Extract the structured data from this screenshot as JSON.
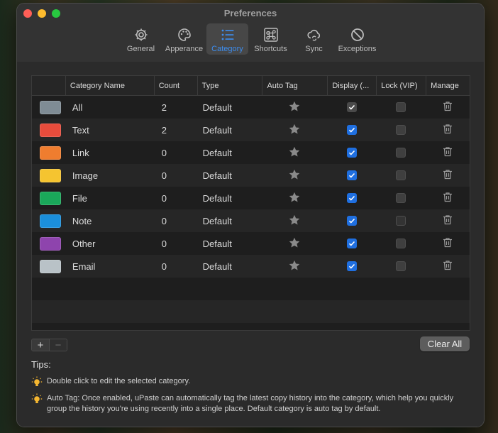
{
  "window": {
    "title": "Preferences"
  },
  "tabs": [
    {
      "label": "General",
      "icon": "gear-icon"
    },
    {
      "label": "Apperance",
      "icon": "palette-icon"
    },
    {
      "label": "Category",
      "icon": "list-icon",
      "active": true
    },
    {
      "label": "Shortcuts",
      "icon": "command-icon"
    },
    {
      "label": "Sync",
      "icon": "cloud-sync-icon"
    },
    {
      "label": "Exceptions",
      "icon": "prohibited-icon"
    }
  ],
  "table": {
    "headers": [
      "",
      "Category Name",
      "Count",
      "Type",
      "Auto Tag",
      "Display (...",
      "Lock (VIP)",
      "Manage"
    ],
    "rows": [
      {
        "color": "#7f8c95",
        "name": "All",
        "count": "2",
        "type": "Default",
        "display": true,
        "display_disabled": true,
        "lock": false,
        "lock_disabled": false
      },
      {
        "color": "#e74c3c",
        "name": "Text",
        "count": "2",
        "type": "Default",
        "display": true,
        "display_disabled": false,
        "lock": false,
        "lock_disabled": false
      },
      {
        "color": "#ef7d2f",
        "name": "Link",
        "count": "0",
        "type": "Default",
        "display": true,
        "display_disabled": false,
        "lock": false,
        "lock_disabled": false
      },
      {
        "color": "#f5c430",
        "name": "Image",
        "count": "0",
        "type": "Default",
        "display": true,
        "display_disabled": false,
        "lock": false,
        "lock_disabled": false
      },
      {
        "color": "#1aa85a",
        "name": "File",
        "count": "0",
        "type": "Default",
        "display": true,
        "display_disabled": false,
        "lock": false,
        "lock_disabled": false
      },
      {
        "color": "#1b8fdb",
        "name": "Note",
        "count": "0",
        "type": "Default",
        "display": true,
        "display_disabled": false,
        "lock": false,
        "lock_disabled": true
      },
      {
        "color": "#8e44ad",
        "name": "Other",
        "count": "0",
        "type": "Default",
        "display": true,
        "display_disabled": false,
        "lock": false,
        "lock_disabled": false
      },
      {
        "color": "#b9c2c7",
        "name": "Email",
        "count": "0",
        "type": "Default",
        "display": true,
        "display_disabled": false,
        "lock": false,
        "lock_disabled": false
      }
    ]
  },
  "controls": {
    "add_label": "+",
    "remove_label": "−",
    "clear_all_label": "Clear All"
  },
  "tips": {
    "title": "Tips:",
    "items": [
      "Double click to edit the selected category.",
      "Auto Tag: Once enabled, uPaste can automatically tag the latest copy history into the category, which help you quickly group the history you're using recently into a single place. Default category is auto tag by default."
    ]
  },
  "colors": {
    "accent": "#3d8ef0",
    "close": "#ff5f57",
    "minimize": "#febc2e",
    "zoom": "#28c840",
    "tip_bulb": "#f5b731"
  }
}
